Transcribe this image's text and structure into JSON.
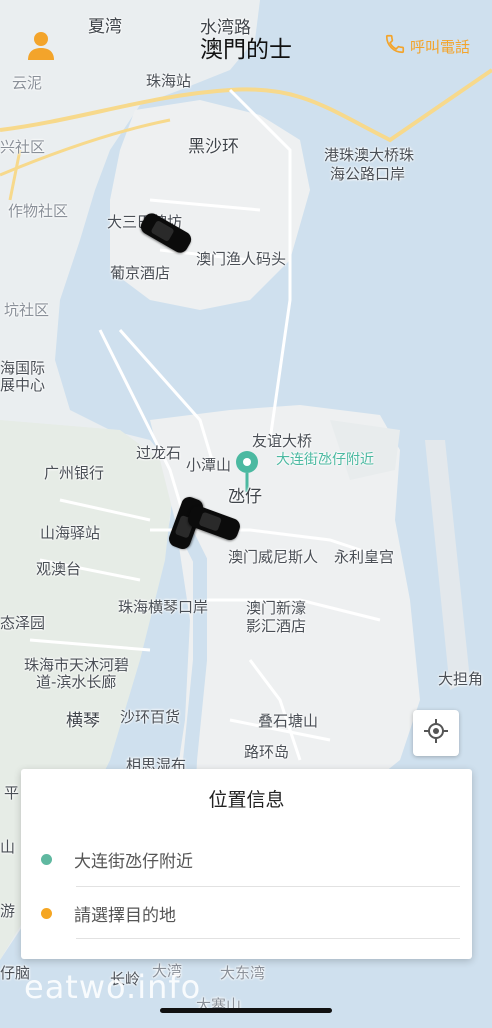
{
  "header": {
    "title": "澳門的士",
    "phone_label": "呼叫電話",
    "user_icon": "person-icon",
    "phone_icon": "phone-icon"
  },
  "map": {
    "labels": {
      "xiawan": "夏湾",
      "shuiwanlu": "水湾路",
      "yunni": "云泥",
      "zhuhaizhan": "珠海站",
      "xingshequ": "兴社区",
      "heishahuan": "黑沙环",
      "gangzhuao": "港珠澳大桥珠",
      "gangzhuao2": "海公路口岸",
      "zuowu": "作物社区",
      "dasanba": "大三巴牌坊",
      "yuren": "澳门渔人码头",
      "pujing": "葡京酒店",
      "kengshe": "坑社区",
      "haiguoji": "海国际",
      "zhanzhongxin": "展中心",
      "youyidaqiao": "友谊大桥",
      "guolongshi": "过龙石",
      "xiaotanshan": "小潭山",
      "location_tag": "大连街氹仔附近",
      "guangzhoubank": "广州银行",
      "taizai": "氹仔",
      "shanhai": "山海驿站",
      "venetian": "澳门威尼斯人",
      "wynn": "永利皇宫",
      "guanaotai": "观澳台",
      "hengqin_port": "珠海横琴口岸",
      "xinhao1": "澳门新濠",
      "xinhao2": "影汇酒店",
      "taizeyuan": "态泽园",
      "tianmu1": "珠海市天沐河碧",
      "tianmu2": "道-滨水长廊",
      "dadanjiao": "大担角",
      "hengqin": "横琴",
      "shahuan": "沙环百货",
      "dieshitang": "叠石塘山",
      "xiangsi": "相思湿布",
      "luhuan": "路环岛",
      "ping": "平",
      "shan": "山",
      "you": "游",
      "zinao": "仔脑",
      "changling": "长岭",
      "dawan": "大湾",
      "dadongwan": "大东湾",
      "dazhai": "大寨山"
    }
  },
  "locate_button": {
    "icon": "crosshair-icon"
  },
  "location_panel": {
    "title": "位置信息",
    "origin": {
      "text": "大连街氹仔附近",
      "color": "#5fb8a0"
    },
    "destination": {
      "placeholder": "請選擇目的地",
      "color": "#f5a623"
    }
  },
  "watermark": "eatwo.info",
  "colors": {
    "accent": "#f3a42b",
    "teal": "#4bb9a1",
    "water": "#cfe0ee",
    "land": "#eef0f1"
  }
}
